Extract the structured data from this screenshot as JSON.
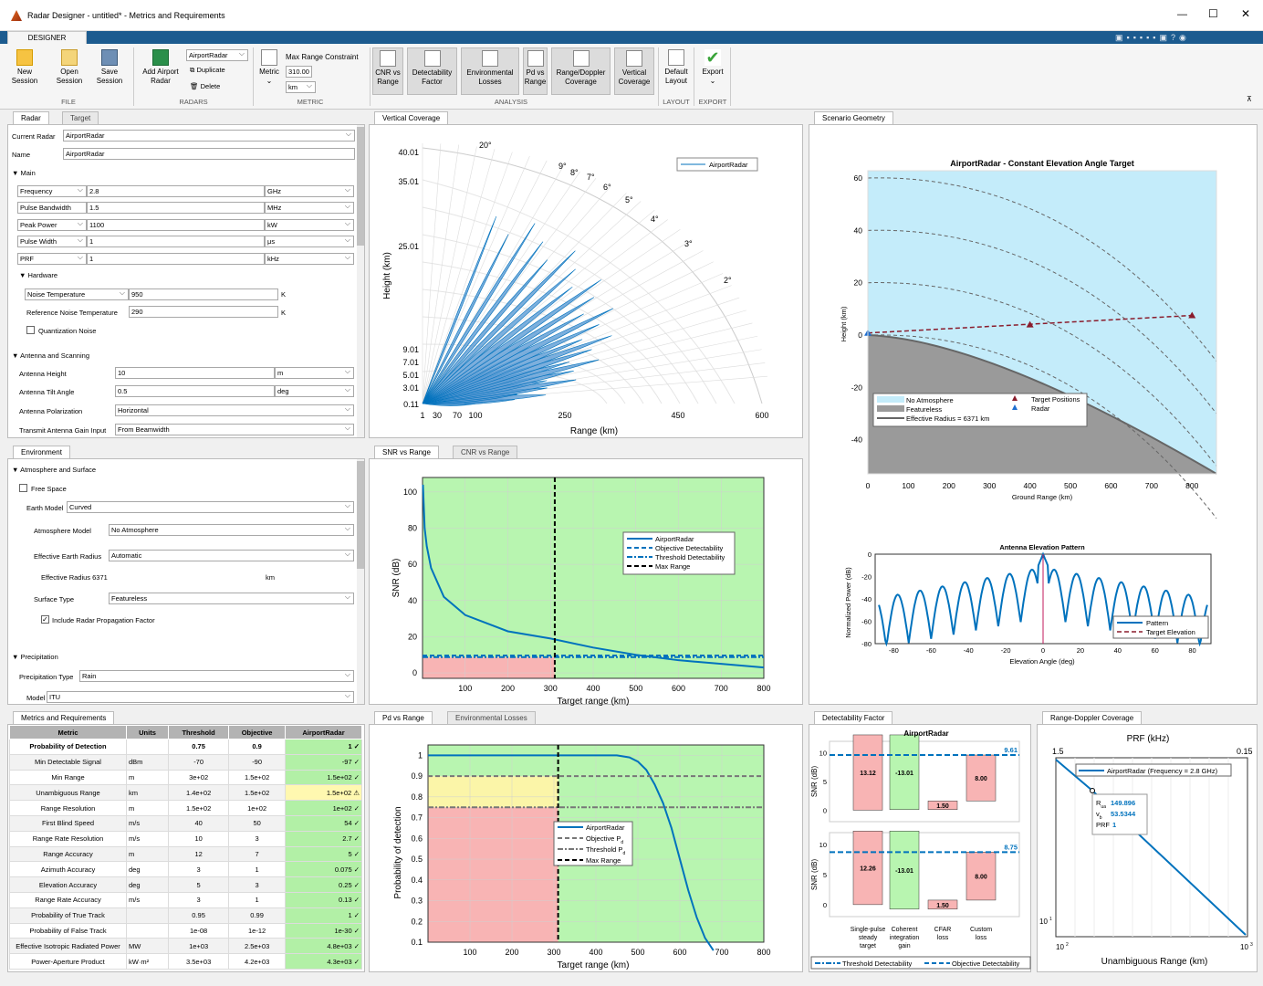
{
  "app": {
    "title": "Radar Designer - untitled* - Metrics and Requirements",
    "tab": "DESIGNER"
  },
  "ribbon": {
    "file": {
      "section": "FILE",
      "new": "New Session",
      "open": "Open Session",
      "save": "Save Session"
    },
    "radars": {
      "section": "RADARS",
      "add": "Add Airport Radar",
      "selected": "AirportRadar",
      "duplicate": "Duplicate",
      "delete": "Delete"
    },
    "metric": {
      "section": "METRIC",
      "metric": "Metric",
      "constraint": "Max Range Constraint",
      "value": "310.00",
      "unit": "km"
    },
    "analysis": {
      "section": "ANALYSIS",
      "items": [
        "CNR vs Range",
        "Detectability Factor",
        "Environmental Losses",
        "Pd vs Range",
        "Range/Doppler Coverage",
        "Vertical Coverage"
      ]
    },
    "layout": {
      "section": "LAYOUT",
      "default": "Default Layout"
    },
    "export": {
      "section": "EXPORT",
      "export": "Export"
    }
  },
  "radarPanel": {
    "tabs": [
      "Radar",
      "Target"
    ],
    "currentRadarLabel": "Current Radar",
    "currentRadar": "AirportRadar",
    "nameLabel": "Name",
    "name": "AirportRadar",
    "main": "▼ Main",
    "params": [
      {
        "label": "Frequency",
        "value": "2.8",
        "unit": "GHz"
      },
      {
        "label": "Pulse Bandwidth",
        "value": "1.5",
        "unit": "MHz"
      },
      {
        "label": "Peak Power",
        "value": "1100",
        "unit": "kW"
      },
      {
        "label": "Pulse Width",
        "value": "1",
        "unit": "μs"
      },
      {
        "label": "PRF",
        "value": "1",
        "unit": "kHz"
      }
    ],
    "hardware": "▼ Hardware",
    "noiseTempLabel": "Noise Temperature",
    "noiseTemp": "950",
    "noiseTempUnit": "K",
    "refNoiseLabel": "Reference Noise Temperature",
    "refNoise": "290",
    "refNoiseUnit": "K",
    "quant": "Quantization Noise",
    "antenna": "▼ Antenna and Scanning",
    "antHeightLabel": "Antenna Height",
    "antHeight": "10",
    "antHeightUnit": "m",
    "tiltLabel": "Antenna Tilt Angle",
    "tilt": "0.5",
    "tiltUnit": "deg",
    "polLabel": "Antenna Polarization",
    "pol": "Horizontal",
    "gainLabel": "Transmit Antenna Gain Input",
    "gain": "From Beamwidth"
  },
  "envPanel": {
    "tab": "Environment",
    "atmos": "▼ Atmosphere and Surface",
    "freeSpace": "Free Space",
    "earthModelLabel": "Earth Model",
    "earthModel": "Curved",
    "atmModelLabel": "Atmosphere Model",
    "atmModel": "No Atmosphere",
    "effRadLabel": "Effective Earth Radius",
    "effRad": "Automatic",
    "effRadiusText": "Effective Radius  6371",
    "effRadiusUnit": "km",
    "surfaceLabel": "Surface Type",
    "surface": "Featureless",
    "includeProp": "Include Radar Propagation Factor",
    "precip": "▼ Precipitation",
    "precipTypeLabel": "Precipitation Type",
    "precipType": "Rain",
    "modelLabel": "Model",
    "model": "ITU"
  },
  "metrics": {
    "tab": "Metrics and Requirements",
    "headers": [
      "Metric",
      "Units",
      "Threshold",
      "Objective",
      "AirportRadar"
    ],
    "rows": [
      [
        "Probability of Detection",
        "",
        "0.75",
        "0.9",
        "1 ✓"
      ],
      [
        "Min Detectable Signal",
        "dBm",
        "-70",
        "-90",
        "-97 ✓"
      ],
      [
        "Min Range",
        "m",
        "3e+02",
        "1.5e+02",
        "1.5e+02 ✓"
      ],
      [
        "Unambiguous Range",
        "km",
        "1.4e+02",
        "1.5e+02",
        "1.5e+02 ⚠"
      ],
      [
        "Range Resolution",
        "m",
        "1.5e+02",
        "1e+02",
        "1e+02 ✓"
      ],
      [
        "First Blind Speed",
        "m/s",
        "40",
        "50",
        "54 ✓"
      ],
      [
        "Range Rate Resolution",
        "m/s",
        "10",
        "3",
        "2.7 ✓"
      ],
      [
        "Range Accuracy",
        "m",
        "12",
        "7",
        "5 ✓"
      ],
      [
        "Azimuth Accuracy",
        "deg",
        "3",
        "1",
        "0.075 ✓"
      ],
      [
        "Elevation Accuracy",
        "deg",
        "5",
        "3",
        "0.25 ✓"
      ],
      [
        "Range Rate Accuracy",
        "m/s",
        "3",
        "1",
        "0.13 ✓"
      ],
      [
        "Probability of True Track",
        "",
        "0.95",
        "0.99",
        "1 ✓"
      ],
      [
        "Probability of False Track",
        "",
        "1e-08",
        "1e-12",
        "1e-30 ✓"
      ],
      [
        "Effective Isotropic Radiated Power",
        "MW",
        "1e+03",
        "2.5e+03",
        "4.8e+03 ✓"
      ],
      [
        "Power-Aperture Product",
        "kW·m²",
        "3.5e+03",
        "4.2e+03",
        "4.3e+03 ✓"
      ]
    ]
  },
  "vc": {
    "tab": "Vertical Coverage",
    "ylabel": "Height (km)",
    "xlabel": "Range (km)",
    "legend": "AirportRadar",
    "yticks": [
      "40.01",
      "35.01",
      "25.01",
      "9.01",
      "7.01",
      "5.01",
      "3.01",
      "0.11"
    ],
    "xticks": [
      "1",
      "30",
      "70",
      "100",
      "250",
      "450",
      "600"
    ],
    "angles": [
      "20°",
      "9°",
      "8°",
      "7°",
      "6°",
      "5°",
      "4°",
      "3°",
      "2°"
    ]
  },
  "snr": {
    "tabs": [
      "SNR vs Range",
      "CNR vs Range"
    ],
    "ylabel": "SNR (dB)",
    "xlabel": "Target range (km)",
    "yticks": [
      "100",
      "80",
      "60",
      "40",
      "20",
      "0"
    ],
    "xticks": [
      "100",
      "200",
      "300",
      "400",
      "500",
      "600",
      "700",
      "800"
    ],
    "legend": [
      "AirportRadar",
      "Objective Detectability",
      "Threshold Detectability",
      "Max Range"
    ]
  },
  "pd": {
    "tabs": [
      "Pd vs Range",
      "Environmental Losses"
    ],
    "ylabel": "Probability of detection",
    "xlabel": "Target range (km)",
    "yticks": [
      "1",
      "0.9",
      "0.8",
      "0.7",
      "0.6",
      "0.5",
      "0.4",
      "0.3",
      "0.2",
      "0.1"
    ],
    "xticks": [
      "100",
      "200",
      "300",
      "400",
      "500",
      "600",
      "700",
      "800"
    ],
    "legend": [
      "AirportRadar",
      "Objective P",
      "Threshold P",
      "Max Range"
    ],
    "sub": "d"
  },
  "geo": {
    "tab": "Scenario Geometry",
    "title": "AirportRadar - Constant Elevation Angle Target",
    "ylabel": "Height (km)",
    "xlabel": "Ground Range (km)",
    "yticks": [
      "60",
      "40",
      "20",
      "0",
      "-20",
      "-40"
    ],
    "xticks": [
      "0",
      "100",
      "200",
      "300",
      "400",
      "500",
      "600",
      "700",
      "800"
    ],
    "legend": [
      "No Atmosphere",
      "Featureless",
      "Effective Radius = 6371 km",
      "Target Positions",
      "Radar"
    ],
    "patTitle": "Antenna Elevation Pattern",
    "patYlabel": "Normalized Power (dB)",
    "patXlabel": "Elevation Angle (deg)",
    "patYticks": [
      "0",
      "-20",
      "-40",
      "-60",
      "-80"
    ],
    "patXticks": [
      "-80",
      "-60",
      "-40",
      "-20",
      "0",
      "20",
      "40",
      "60",
      "80"
    ],
    "patLegend": [
      "Pattern",
      "Target Elevation"
    ]
  },
  "df": {
    "tab": "Detectability Factor",
    "title": "AirportRadar",
    "ylabel": "SNR (dB)",
    "top": {
      "vals": [
        "13.12",
        "-13.01",
        "1.50",
        "8.00"
      ],
      "line": "9.61"
    },
    "bot": {
      "vals": [
        "12.26",
        "-13.01",
        "1.50",
        "8.00"
      ],
      "line": "8.75"
    },
    "cats": [
      "Single-pulse steady target",
      "Coherent integration gain",
      "CFAR loss",
      "Custom loss"
    ],
    "legend": [
      "Threshold Detectability",
      "Objective Detectability"
    ]
  },
  "rd": {
    "tab": "Range-Doppler Coverage",
    "title": "PRF (kHz)",
    "xlabel": "Unambiguous Range (km)",
    "tl": "1.5",
    "tr": "0.15",
    "legend": "AirportRadar (Frequency = 2.8 GHz)",
    "tip": [
      "149.896",
      "53.5344",
      "1"
    ]
  },
  "chart_data": [
    {
      "type": "line",
      "title": "",
      "xlabel": "Target range (km)",
      "ylabel": "SNR (dB)",
      "xlim": [
        0,
        800
      ],
      "ylim": [
        -3,
        108
      ],
      "series": [
        {
          "name": "AirportRadar",
          "x": [
            1,
            5,
            10,
            20,
            50,
            100,
            200,
            300,
            400,
            500,
            600,
            700,
            800
          ],
          "y": [
            104,
            80,
            70,
            58,
            42,
            32,
            23,
            19,
            14,
            10,
            7,
            5,
            3
          ]
        },
        {
          "name": "Objective Detectability",
          "y": 9.61
        },
        {
          "name": "Threshold Detectability",
          "y": 8.75
        },
        {
          "name": "Max Range",
          "x": 310
        }
      ]
    },
    {
      "type": "line",
      "xlabel": "Target range (km)",
      "ylabel": "Probability of detection",
      "xlim": [
        0,
        800
      ],
      "ylim": [
        0.1,
        1.05
      ],
      "series": [
        {
          "name": "AirportRadar",
          "x": [
            0,
            450,
            480,
            500,
            520,
            540,
            560,
            580,
            600,
            620,
            640,
            660,
            680
          ],
          "y": [
            1,
            1,
            0.99,
            0.97,
            0.93,
            0.86,
            0.77,
            0.65,
            0.5,
            0.35,
            0.22,
            0.12,
            0.06
          ]
        },
        {
          "name": "Objective Pd",
          "y": 0.9
        },
        {
          "name": "Threshold Pd",
          "y": 0.75
        },
        {
          "name": "Max Range",
          "x": 310
        }
      ]
    },
    {
      "type": "bar",
      "title": "AirportRadar",
      "categories": [
        "Single-pulse steady target",
        "Coherent integration gain",
        "CFAR loss",
        "Custom loss"
      ],
      "series": [
        {
          "values": [
            13.12,
            -13.01,
            1.5,
            8.0
          ]
        },
        {
          "values": [
            12.26,
            -13.01,
            1.5,
            8.0
          ]
        }
      ],
      "lines": [
        9.61,
        8.75
      ]
    }
  ]
}
